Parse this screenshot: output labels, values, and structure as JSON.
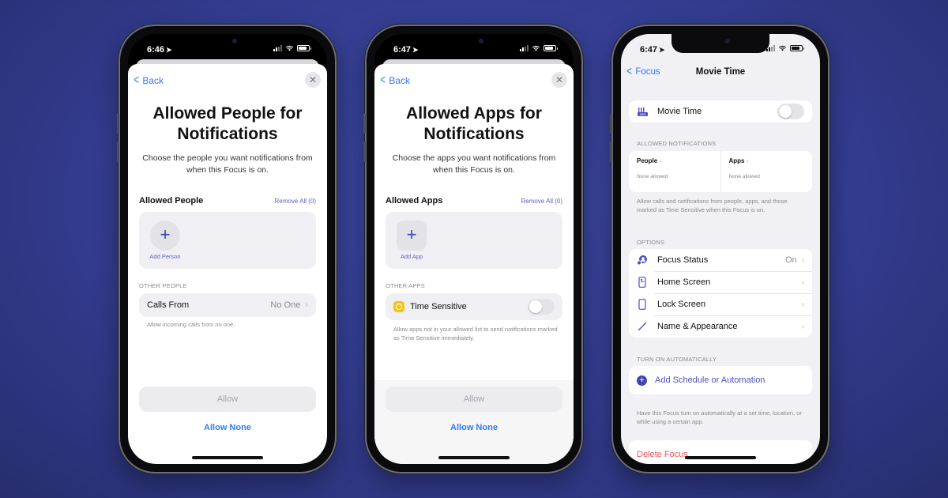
{
  "background_color": "#343d93",
  "phones": {
    "people": {
      "status_time": "6:46",
      "back_label": "Back",
      "close_icon": "close-icon",
      "title": "Allowed People for Notifications",
      "subtitle": "Choose the people you want notifications from when this Focus is on.",
      "section_title": "Allowed People",
      "remove_all": "Remove All (0)",
      "add_label": "Add Person",
      "other_header": "OTHER PEOPLE",
      "row_label": "Calls From",
      "row_value": "No One",
      "row_footer": "Allow incoming calls from no one.",
      "allow_button": "Allow",
      "allow_none": "Allow None"
    },
    "apps": {
      "status_time": "6:47",
      "back_label": "Back",
      "title": "Allowed Apps for Notifications",
      "subtitle": "Choose the apps you want notifications from when this Focus is on.",
      "section_title": "Allowed Apps",
      "remove_all": "Remove All (0)",
      "add_label": "Add App",
      "other_header": "OTHER APPS",
      "row_label": "Time Sensitive",
      "row_toggle_on": false,
      "row_footer": "Allow apps not in your allowed list to send notifications marked as Time Sensitive immediately.",
      "allow_button": "Allow",
      "allow_none": "Allow None"
    },
    "settings": {
      "status_time": "6:47",
      "nav_back": "Focus",
      "nav_title": "Movie Time",
      "focus_name": "Movie Time",
      "focus_toggle_on": false,
      "allowed_header": "ALLOWED NOTIFICATIONS",
      "people_label": "People",
      "people_value": "None allowed",
      "apps_label": "Apps",
      "apps_value": "None allowed",
      "allowed_footer": "Allow calls and notifications from people, apps, and those marked as Time Sensitive when this Focus is on.",
      "options_header": "OPTIONS",
      "options": [
        {
          "label": "Focus Status",
          "value": "On",
          "icon": "focus-status-icon"
        },
        {
          "label": "Home Screen",
          "value": "",
          "icon": "home-screen-icon"
        },
        {
          "label": "Lock Screen",
          "value": "",
          "icon": "lock-screen-icon"
        },
        {
          "label": "Name & Appearance",
          "value": "",
          "icon": "pencil-icon"
        }
      ],
      "auto_header": "TURN ON AUTOMATICALLY",
      "add_schedule": "Add Schedule or Automation",
      "auto_footer": "Have this Focus turn on automatically at a set time, location, or while using a certain app.",
      "delete_label": "Delete Focus"
    }
  },
  "colors": {
    "accent_blue": "#2f7cf6",
    "focus_indigo": "#4b4fc4",
    "destructive": "#f0535a",
    "time_sensitive_yellow": "#f5c518"
  }
}
